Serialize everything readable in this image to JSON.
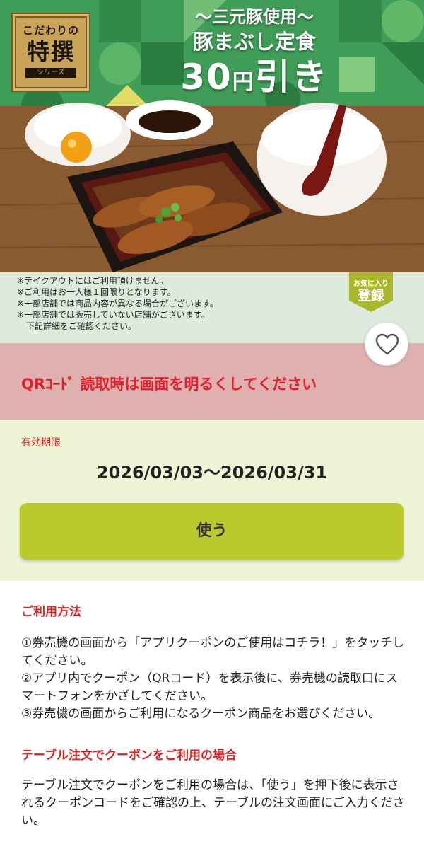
{
  "banner": {
    "logo": {
      "top": "こだわりの",
      "big": "特撰",
      "bottom": "シリーズ"
    },
    "headline_line1": "〜三元豚使用〜",
    "headline_line2": "豚まぶし定食",
    "discount_amount": "30",
    "discount_unit": "円",
    "discount_suffix": "引き"
  },
  "notes": [
    "※テイクアウトにはご利用頂けません。",
    "※ご利用はお一人様１回限りとなります。",
    "※一部店舗では商品内容が異なる場合がございます。",
    "※一部店舗では販売していない店舗がございます。",
    "下記詳細をご確認ください。"
  ],
  "favorite_tag": {
    "line1": "お気に入り",
    "line2": "登録"
  },
  "icons": {
    "favorite": "heart-outline-icon"
  },
  "alert": {
    "message": "QRｺｰﾄﾞ 読取時は画面を明るくしてください"
  },
  "validity": {
    "label": "有効期限",
    "range": "2026/03/03〜2026/03/31"
  },
  "use_button": {
    "label": "使う"
  },
  "howto": {
    "title": "ご利用方法",
    "steps": [
      "①券売機の画面から「アプリクーポンのご使用はコチラ！」をタッチしてください。",
      "②アプリ内でクーポン（QRコード）を表示後に、券売機の読取口にスマートフォンをかざしてください。",
      "③券売機の画面からご利用になるクーポン商品をお選びください。"
    ]
  },
  "table_order": {
    "title": "テーブル注文でクーポンをご利用の場合",
    "body": "テーブル注文でクーポンをご利用の場合は、「使う」を押下後に表示されるクーポンコードをご確認の上、テーブルの注文画面にご入力ください。"
  },
  "colors": {
    "accent_red": "#e41e2a",
    "button_green": "#bcc92c",
    "alert_bg": "#dfb0b0",
    "validity_bg": "#eef5d6",
    "notes_bg": "#dcebdc"
  }
}
